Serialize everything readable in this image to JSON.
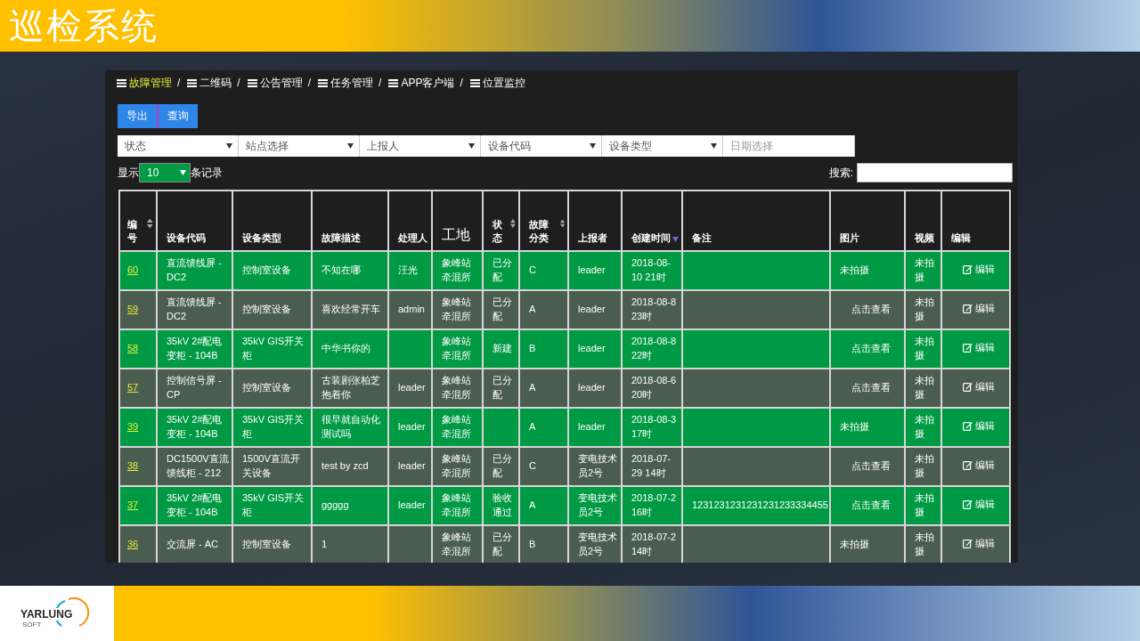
{
  "app_title": "巡检系统",
  "nav": [
    {
      "label": "故障管理",
      "selected": true,
      "separator": "/"
    },
    {
      "label": "二维码",
      "selected": false,
      "separator": "/"
    },
    {
      "label": "公告管理",
      "selected": false,
      "separator": "/"
    },
    {
      "label": "任务管理",
      "selected": false,
      "separator": "/"
    },
    {
      "label": "APP客户端",
      "selected": false,
      "separator": "/"
    },
    {
      "label": "位置监控",
      "selected": false
    }
  ],
  "actions": [
    "导出",
    "查询"
  ],
  "filters": [
    {
      "kind": "select",
      "placeholder": "状态"
    },
    {
      "kind": "select",
      "placeholder": "站点选择"
    },
    {
      "kind": "select",
      "placeholder": "上报人"
    },
    {
      "kind": "select",
      "placeholder": "设备代码"
    },
    {
      "kind": "select",
      "placeholder": "设备类型"
    },
    {
      "kind": "date",
      "placeholder": "日期选择"
    }
  ],
  "page_length": {
    "prefix": "显示",
    "value": "10",
    "suffix": "条记录"
  },
  "search": {
    "label": "搜索:"
  },
  "table": {
    "columns": [
      {
        "label": "编号",
        "kind": "standard",
        "sortable": true,
        "sorted_descending": false
      },
      {
        "label": "设备代码",
        "kind": "standard",
        "sortable": false
      },
      {
        "label": "设备类型",
        "kind": "standard",
        "sortable": false
      },
      {
        "label": "故障描述",
        "kind": "standard",
        "sortable": false
      },
      {
        "label": "处理人",
        "kind": "standard",
        "sortable": false
      },
      {
        "label": "工地",
        "kind": "large",
        "sortable": false
      },
      {
        "label": "状态",
        "kind": "standard",
        "sortable": true,
        "sorted_descending": false
      },
      {
        "label": "故障分类",
        "kind": "standard",
        "sortable": true,
        "sorted_descending": false
      },
      {
        "label": "上报者",
        "kind": "standard",
        "sortable": false
      },
      {
        "label": "创建时间",
        "kind": "standard",
        "sortable": true,
        "sorted_descending": true
      },
      {
        "label": "备注",
        "kind": "standard",
        "sortable": false
      },
      {
        "label": "图片",
        "kind": "standard",
        "sortable": false
      },
      {
        "label": "视频",
        "kind": "standard",
        "sortable": false
      },
      {
        "label": "编辑",
        "kind": "standard",
        "sortable": false
      }
    ],
    "rows": [
      {
        "highlighted": true,
        "id": "60",
        "code": "直流馈线屏 - DC2",
        "type": "控制室设备",
        "desc": "不知在哪",
        "handler": "汪光",
        "site": "象峰站牵混所",
        "status": "已分配",
        "category": "C",
        "reporter": "leader",
        "created": "2018-08-10 21时",
        "picture": {
          "kind": "none",
          "text": "未拍摄"
        },
        "video": "未拍摄",
        "edit": "编辑"
      },
      {
        "highlighted": false,
        "id": "59",
        "code": "直流馈线屏 - DC2",
        "type": "控制室设备",
        "desc": "喜欢经常开车",
        "handler": "admin",
        "site": "象峰站牵混所",
        "status": "已分配",
        "category": "A",
        "reporter": "leader",
        "created": "2018-08-8 23时",
        "picture": {
          "kind": "link",
          "text": "点击查看"
        },
        "video": "未拍摄",
        "edit": "编辑"
      },
      {
        "highlighted": true,
        "id": "58",
        "code": "35kV 2#配电变柜 - 104B",
        "type": "35kV GIS开关柜",
        "desc": "中华书你的",
        "site": "象峰站牵混所",
        "status": "新建",
        "category": "B",
        "reporter": "leader",
        "created": "2018-08-8 22时",
        "picture": {
          "kind": "link",
          "text": "点击查看"
        },
        "video": "未拍摄",
        "edit": "编辑"
      },
      {
        "highlighted": false,
        "id": "57",
        "code": "控制信号屏 - CP",
        "type": "控制室设备",
        "desc": "古装剧张柏芝抱着你",
        "handler": "leader",
        "site": "象峰站牵混所",
        "status": "已分配",
        "category": "A",
        "reporter": "leader",
        "created": "2018-08-6 20时",
        "picture": {
          "kind": "link",
          "text": "点击查看"
        },
        "video": "未拍摄",
        "edit": "编辑"
      },
      {
        "highlighted": true,
        "id": "39",
        "code": "35kV 2#配电变柜 - 104B",
        "type": "35kV GIS开关柜",
        "desc": "很早就自动化测试吗",
        "handler": "leader",
        "site": "象峰站牵混所",
        "category": "A",
        "reporter": "leader",
        "created": "2018-08-3 17时",
        "picture": {
          "kind": "none",
          "text": "未拍摄"
        },
        "video": "未拍摄",
        "edit": "编辑"
      },
      {
        "highlighted": false,
        "id": "38",
        "code": "DC1500V直流馈线柜 - 212",
        "type": "1500V直流开关设备",
        "desc": "test by zcd",
        "handler": "leader",
        "site": "象峰站牵混所",
        "status": "已分配",
        "category": "C",
        "reporter": "变电技术员2号",
        "created": "2018-07-29 14时",
        "picture": {
          "kind": "link",
          "text": "点击查看"
        },
        "video": "未拍摄",
        "edit": "编辑"
      },
      {
        "highlighted": true,
        "id": "37",
        "code": "35kV 2#配电变柜 - 104B",
        "type": "35kV GIS开关柜",
        "desc": "ggggg",
        "handler": "leader",
        "site": "象峰站牵混所",
        "status": "验收通过",
        "category": "A",
        "reporter": "变电技术员2号",
        "created": "2018-07-2 16时",
        "note": "1231231231231231233334455",
        "picture": {
          "kind": "link",
          "text": "点击查看"
        },
        "video": "未拍摄",
        "edit": "编辑"
      },
      {
        "highlighted": false,
        "id": "36",
        "code": "交流屏 - AC",
        "type": "控制室设备",
        "desc": "1",
        "site": "象峰站牵混所",
        "status": "已分配",
        "category": "B",
        "reporter": "变电技术员2号",
        "created": "2018-07-2 14时",
        "picture": {
          "kind": "none",
          "text": "未拍摄"
        },
        "video": "未拍摄",
        "edit": "编辑"
      }
    ]
  },
  "footer_logo": {
    "name": "YARLUNG",
    "sub": "SOFT"
  }
}
